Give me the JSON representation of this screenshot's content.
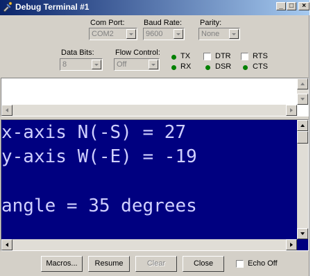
{
  "window": {
    "title": "Debug Terminal #1",
    "controls": {
      "minimize": "_",
      "maximize": "□",
      "close": "×"
    }
  },
  "settings": {
    "com_port": {
      "label": "Com Port:",
      "value": "COM2"
    },
    "baud_rate": {
      "label": "Baud Rate:",
      "value": "9600"
    },
    "parity": {
      "label": "Parity:",
      "value": "None"
    },
    "data_bits": {
      "label": "Data Bits:",
      "value": "8"
    },
    "flow_control": {
      "label": "Flow Control:",
      "value": "Off"
    }
  },
  "indicators": {
    "tx": "TX",
    "rx": "RX",
    "dtr": "DTR",
    "rts": "RTS",
    "dsr": "DSR",
    "cts": "CTS",
    "led_color": "#008000"
  },
  "transmit": {
    "text": ""
  },
  "receive": {
    "lines": [
      "x-axis N(-S) = 27",
      "y-axis W(-E) = -19",
      "",
      "angle = 35 degrees"
    ],
    "background": "#000080",
    "text_color": "#d0d0ff"
  },
  "buttons": {
    "macros": "Macros...",
    "resume": "Resume",
    "clear": "Clear",
    "close": "Close",
    "echo_off": "Echo Off"
  }
}
